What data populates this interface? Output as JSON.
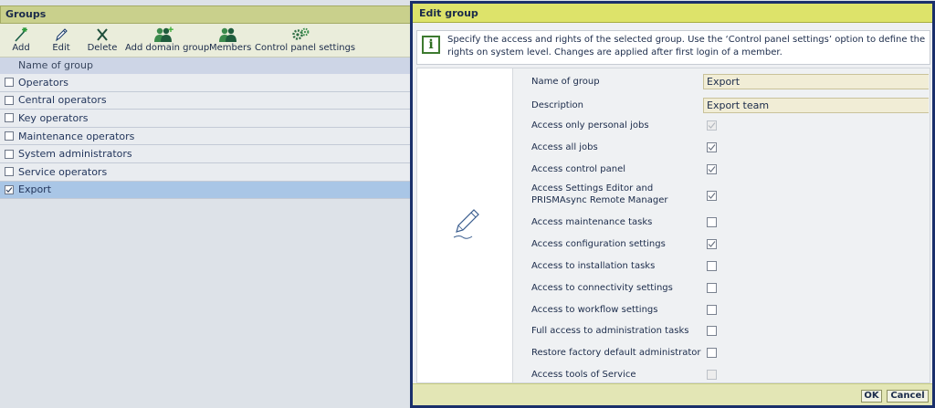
{
  "groups_panel": {
    "title": "Groups",
    "toolbar": {
      "add": "Add",
      "edit": "Edit",
      "delete": "Delete",
      "add_domain_group": "Add domain group",
      "members": "Members",
      "control_panel_settings": "Control panel settings"
    },
    "column_header": "Name of group",
    "groups": [
      {
        "name": "Operators",
        "checked": false
      },
      {
        "name": "Central operators",
        "checked": false
      },
      {
        "name": "Key operators",
        "checked": false
      },
      {
        "name": "Maintenance operators",
        "checked": false
      },
      {
        "name": "System administrators",
        "checked": false
      },
      {
        "name": "Service operators",
        "checked": false
      },
      {
        "name": "Export",
        "checked": true,
        "selected": true
      }
    ]
  },
  "dialog": {
    "title": "Edit group",
    "info": "Specify the access and rights of the selected group. Use the ‘Control panel settings’ option to define the rights on system level. Changes are applied after first login of a member.",
    "name_label": "Name of group",
    "name_value": "Export",
    "description_label": "Description",
    "description_value": "Export team",
    "permissions": [
      {
        "label": "Access only personal jobs",
        "checked": true,
        "disabled": true
      },
      {
        "label": "Access all jobs",
        "checked": true,
        "disabled": false
      },
      {
        "label": "Access control panel",
        "checked": true,
        "disabled": false
      },
      {
        "label": "Access Settings Editor and PRISMAsync Remote Manager",
        "checked": true,
        "disabled": false
      },
      {
        "label": "Access maintenance tasks",
        "checked": false,
        "disabled": false
      },
      {
        "label": "Access configuration settings",
        "checked": true,
        "disabled": false
      },
      {
        "label": "Access to installation tasks",
        "checked": false,
        "disabled": false
      },
      {
        "label": "Access to connectivity settings",
        "checked": false,
        "disabled": false
      },
      {
        "label": "Access to workflow settings",
        "checked": false,
        "disabled": false
      },
      {
        "label": "Full access to administration tasks",
        "checked": false,
        "disabled": false
      },
      {
        "label": "Restore factory default administrator",
        "checked": false,
        "disabled": false
      },
      {
        "label": "Access tools of Service",
        "checked": false,
        "disabled": true
      }
    ],
    "ok_label": "OK",
    "cancel_label": "Cancel"
  },
  "colors": {
    "title_bar": "#c9d08c",
    "dialog_title_bar": "#dde36a",
    "dialog_border": "#1a2f6b",
    "selected_row": "#a9c6e6"
  }
}
